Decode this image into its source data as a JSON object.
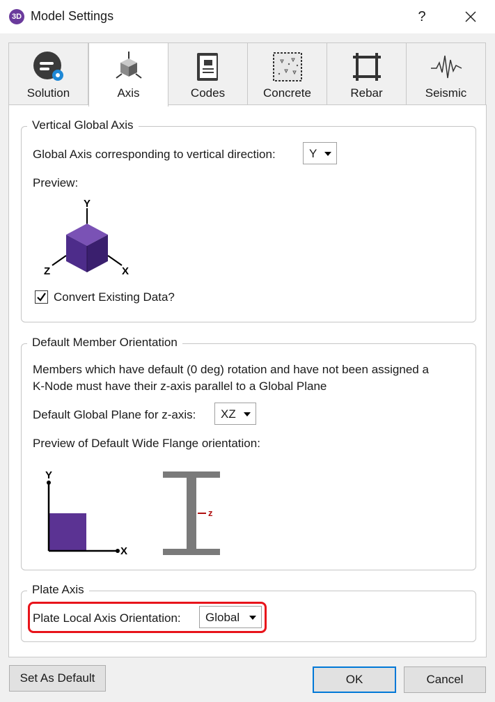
{
  "window": {
    "app_icon_text": "3D",
    "title": "Model Settings",
    "help": "?"
  },
  "tabs": [
    {
      "label": "Solution",
      "icon": "solution-icon",
      "active": false
    },
    {
      "label": "Axis",
      "icon": "axis-icon",
      "active": true
    },
    {
      "label": "Codes",
      "icon": "codes-icon",
      "active": false
    },
    {
      "label": "Concrete",
      "icon": "concrete-icon",
      "active": false
    },
    {
      "label": "Rebar",
      "icon": "rebar-icon",
      "active": false
    },
    {
      "label": "Seismic",
      "icon": "seismic-icon",
      "active": false
    }
  ],
  "vertical_axis": {
    "legend": "Vertical Global Axis",
    "axis_label": "Global Axis corresponding to vertical direction:",
    "axis_value": "Y",
    "preview_label": "Preview:",
    "cube_labels": {
      "y": "Y",
      "z": "Z",
      "x": "X"
    },
    "convert_label": "Convert Existing Data?",
    "convert_checked": true
  },
  "member_orientation": {
    "legend": "Default Member Orientation",
    "description_line1": "Members which have default (0 deg) rotation and have not been assigned a",
    "description_line2": "K-Node must have their z-axis parallel to a Global Plane",
    "plane_label": "Default Global Plane for z-axis:",
    "plane_value": "XZ",
    "preview_label": "Preview of Default Wide Flange orientation:",
    "axis_labels": {
      "y": "Y",
      "x": "X",
      "z": "z"
    }
  },
  "plate_axis": {
    "legend": "Plate Axis",
    "orientation_label": "Plate Local Axis Orientation:",
    "orientation_value": "Global"
  },
  "buttons": {
    "set_default": "Set As Default",
    "ok": "OK",
    "cancel": "Cancel"
  },
  "colors": {
    "accent_purple": "#5b3393",
    "highlight_red": "#e8141b",
    "default_button_border": "#0078d7"
  }
}
